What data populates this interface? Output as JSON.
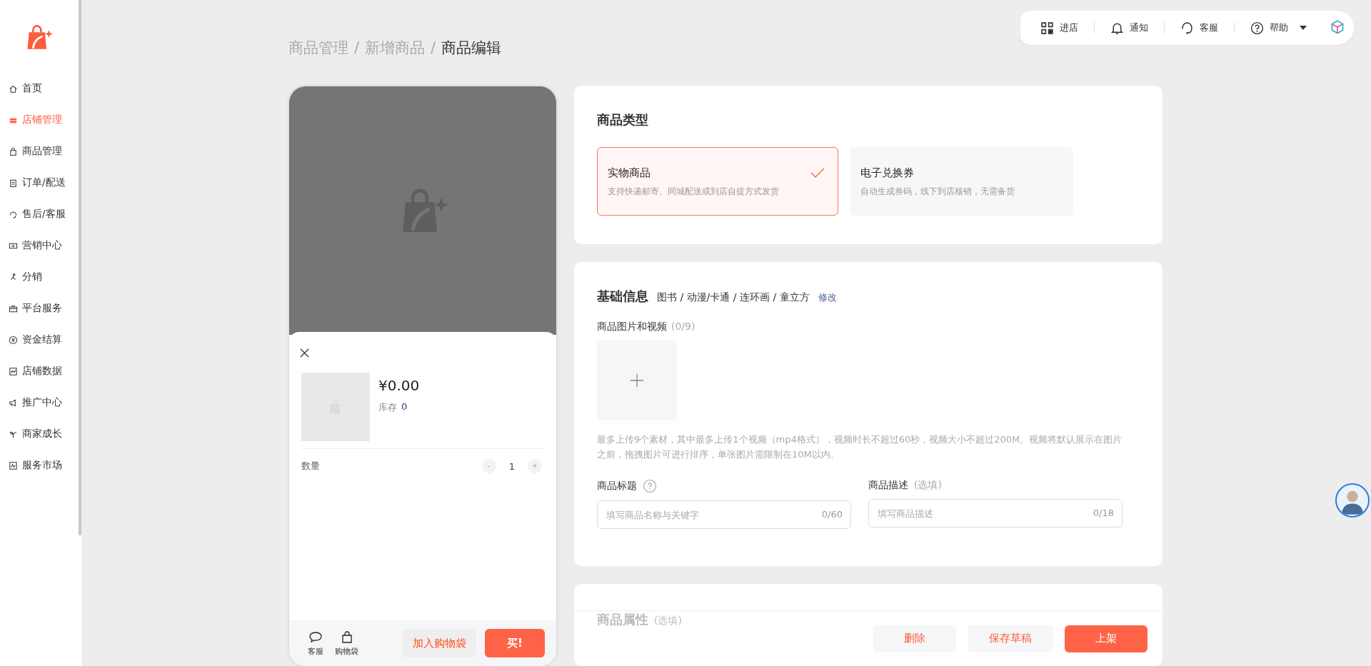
{
  "sidebar": {
    "items": [
      {
        "label": "首页",
        "selected": false
      },
      {
        "label": "店铺管理",
        "selected": true
      },
      {
        "label": "商品管理",
        "selected": false
      },
      {
        "label": "订单/配送",
        "selected": false
      },
      {
        "label": "售后/客服",
        "selected": false
      },
      {
        "label": "营销中心",
        "selected": false
      },
      {
        "label": "分销",
        "selected": false
      },
      {
        "label": "平台服务",
        "selected": false
      },
      {
        "label": "资金结算",
        "selected": false
      },
      {
        "label": "店铺数据",
        "selected": false
      },
      {
        "label": "推广中心",
        "selected": false
      },
      {
        "label": "商家成长",
        "selected": false
      },
      {
        "label": "服务市场",
        "selected": false
      }
    ]
  },
  "breadcrumb": [
    {
      "label": "商品管理",
      "sep": "/"
    },
    {
      "label": "新增商品",
      "sep": "/"
    },
    {
      "label": "商品编辑"
    }
  ],
  "topbar": {
    "items": [
      {
        "label": "进店"
      },
      {
        "label": "通知"
      },
      {
        "label": "客服"
      },
      {
        "label": "帮助"
      }
    ]
  },
  "preview": {
    "price": "¥0.00",
    "stock_label": "库存",
    "stock": "0",
    "quantity_label": "数量",
    "quantity": "1",
    "minus": "-",
    "plus": "+",
    "bottom_icons": [
      {
        "label": "客服"
      },
      {
        "label": "购物袋"
      }
    ],
    "add_to_bag": "加入购物袋",
    "buy": "买!"
  },
  "product_type": {
    "title": "商品类型",
    "options": [
      {
        "title": "实物商品",
        "desc": "支持快递邮寄、同城配送或到店自提方式发货",
        "selected": true
      },
      {
        "title": "电子兑换券",
        "desc": "自动生成券码，线下到店核销，无需备货",
        "selected": false
      }
    ]
  },
  "basic_info": {
    "title": "基础信息",
    "category": "图书 / 动漫/卡通 / 连环画 / 童立方",
    "edit_link": "修改",
    "media_label": "商品图片和视频",
    "media_count": "(0/9)",
    "hint": "最多上传9个素材，其中最多上传1个视频（mp4格式），视频时长不超过60秒，视频大小不超过200M。视频将默认展示在图片之前，拖拽图片可进行排序，单张图片需限制在10M以内。",
    "fields": [
      {
        "label": "商品标题",
        "help": true,
        "placeholder": "填写商品名称与关键字",
        "count": "0/60"
      },
      {
        "label": "商品描述",
        "note": "(选填)",
        "help": false,
        "placeholder": "填写商品描述",
        "count": "0/18"
      }
    ]
  },
  "attributes": {
    "title": "商品属性",
    "note": "(选填)"
  },
  "actions": [
    {
      "label": "删除",
      "primary": false
    },
    {
      "label": "保存草稿",
      "primary": false
    },
    {
      "label": "上架",
      "primary": true
    }
  ]
}
